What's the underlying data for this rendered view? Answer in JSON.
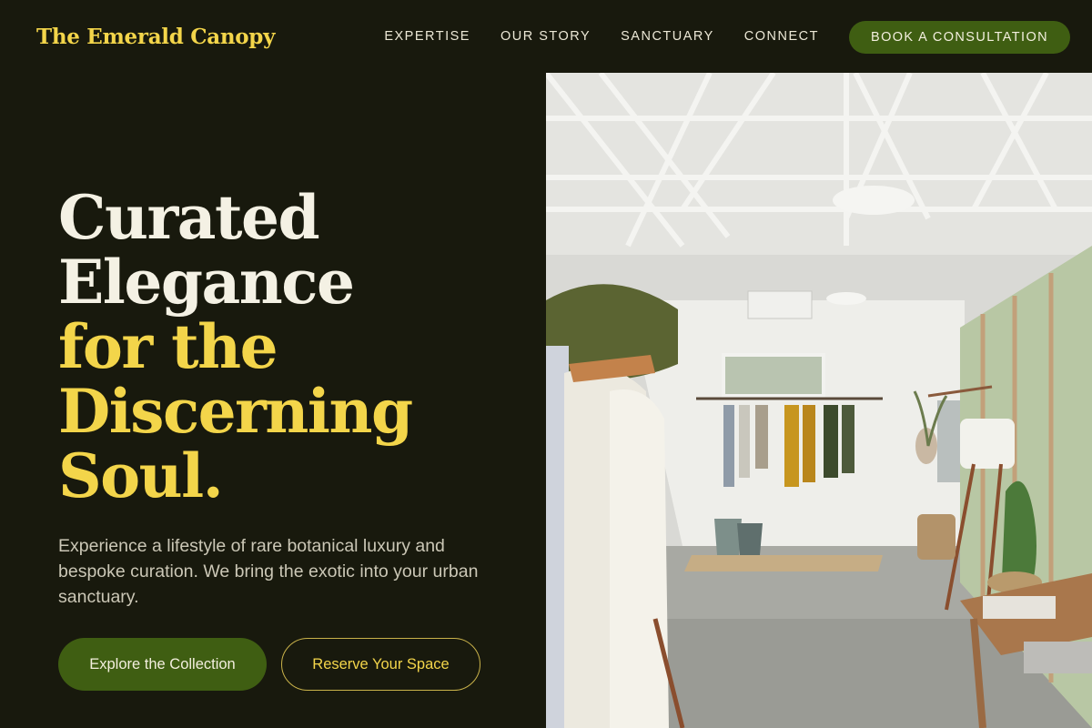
{
  "brand": {
    "name": "The Emerald Canopy"
  },
  "nav": {
    "links": [
      "EXPERTISE",
      "OUR STORY",
      "SANCTUARY",
      "CONNECT"
    ],
    "cta_label": "BOOK A CONSULTATION"
  },
  "hero": {
    "title_lines": [
      "Curated",
      "Elegance",
      "for the",
      "Discerning",
      "Soul."
    ],
    "description": "Experience a lifestyle of rare botanical luxury and bespoke curation. We bring the exotic into your urban sanctuary.",
    "primary_button": "Explore the Collection",
    "secondary_button": "Reserve Your Space"
  },
  "colors": {
    "background": "#18190d",
    "accent_yellow": "#f3d54a",
    "accent_green": "#3f5e12",
    "heading_light": "#f4f1e4",
    "body_text": "#cbc7b6"
  },
  "photo": {
    "subject": "boutique-interior-image"
  }
}
